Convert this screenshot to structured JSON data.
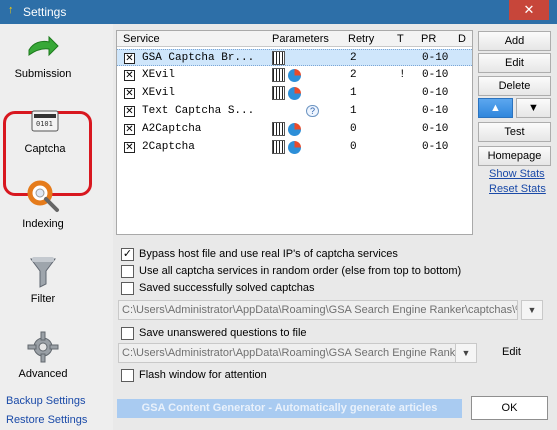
{
  "window": {
    "title": "Settings",
    "close_symbol": "✕"
  },
  "sidebar": {
    "items": [
      {
        "label": "Submission",
        "icon": "arrow-right-icon"
      },
      {
        "label": "Captcha",
        "icon": "captcha-icon"
      },
      {
        "label": "Indexing",
        "icon": "lifebuoy-search-icon"
      },
      {
        "label": "Filter",
        "icon": "funnel-icon"
      },
      {
        "label": "Advanced",
        "icon": "gear-icon"
      }
    ],
    "backup_link": "Backup Settings",
    "restore_link": "Restore Settings"
  },
  "table": {
    "headers": [
      "Service",
      "Parameters",
      "Retry",
      "T",
      "PR",
      "D"
    ],
    "rows": [
      {
        "service": "GSA Captcha Br...",
        "retry": "2",
        "t": "",
        "pr": "0-10",
        "checked": "✕"
      },
      {
        "service": "XEvil",
        "retry": "2",
        "t": "!",
        "pr": "0-10",
        "checked": "✕"
      },
      {
        "service": "XEvil",
        "retry": "1",
        "t": "",
        "pr": "0-10",
        "checked": "✕"
      },
      {
        "service": "Text Captcha S...",
        "retry": "1",
        "t": "",
        "pr": "0-10",
        "checked": "✕"
      },
      {
        "service": "A2Captcha",
        "retry": "0",
        "t": "",
        "pr": "0-10",
        "checked": "✕"
      },
      {
        "service": "2Captcha",
        "retry": "0",
        "t": "",
        "pr": "0-10",
        "checked": "✕"
      }
    ]
  },
  "buttons": {
    "add": "Add",
    "edit": "Edit",
    "delete": "Delete",
    "up": "▲",
    "down": "▼",
    "test": "Test",
    "homepage": "Homepage",
    "show_stats": "Show Stats",
    "reset_stats": "Reset Stats",
    "ok": "OK",
    "edit_path": "Edit",
    "dropdown": "▼"
  },
  "options": [
    {
      "label": "Bypass host file and use real IP's of captcha services",
      "checked": "✓"
    },
    {
      "label": "Use all captcha services in random order (else from top to bottom)",
      "checked": ""
    },
    {
      "label": "Saved successfully solved captchas",
      "checked": ""
    },
    {
      "label": "Save unanswered questions to file",
      "checked": ""
    },
    {
      "label": "Flash window for attention",
      "checked": ""
    }
  ],
  "paths": {
    "solved": "C:\\Users\\Administrator\\AppData\\Roaming\\GSA Search Engine Ranker\\captchas\\%",
    "unanswered": "C:\\Users\\Administrator\\AppData\\Roaming\\GSA Search Engine Ranker\\"
  },
  "banner": "GSA Content Generator - Automatically generate articles",
  "colors": {
    "accent": "#2d6fa8",
    "highlight": "#d8171f",
    "selected_row": "#cfe6fb"
  }
}
